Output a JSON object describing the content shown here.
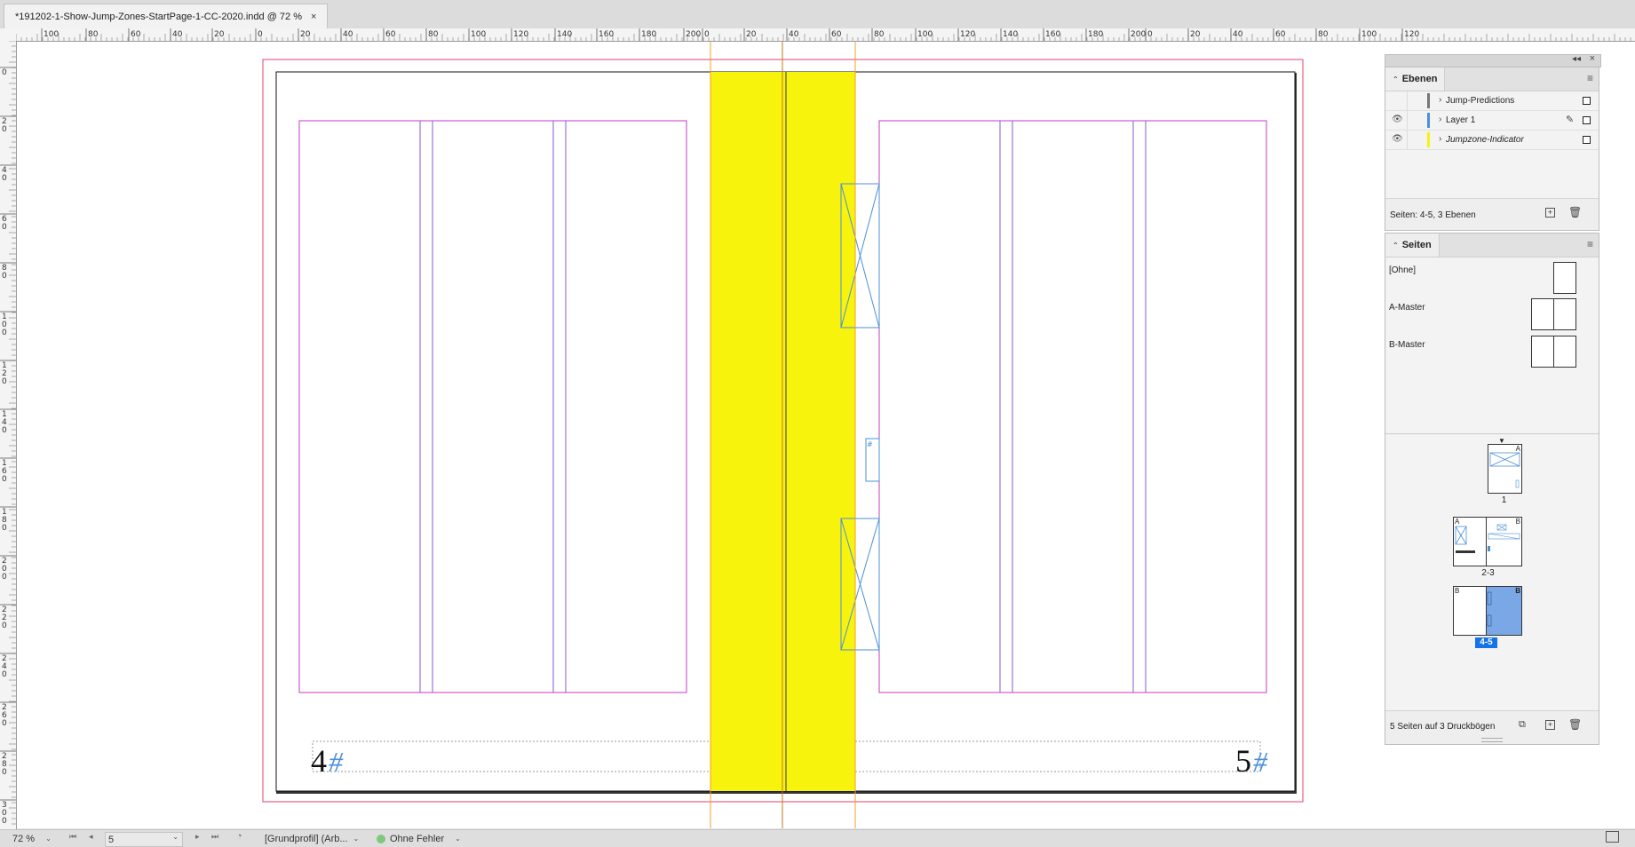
{
  "document_tab": {
    "title": "*191202-1-Show-Jump-Zones-StartPage-1-CC-2020.indd @ 72 %",
    "close_glyph": "×"
  },
  "rulers": {
    "horizontal_labels": [
      "100",
      "80",
      "60",
      "40",
      "20",
      "0",
      "20",
      "40",
      "60",
      "80",
      "100",
      "120",
      "140",
      "160",
      "180",
      "200",
      "0",
      "20",
      "40",
      "60",
      "80",
      "100",
      "120",
      "140",
      "160",
      "180",
      "200",
      "0",
      "20",
      "40",
      "60",
      "80",
      "100",
      "120"
    ],
    "vertical_labels": [
      "0",
      "20",
      "40",
      "60",
      "80",
      "100",
      "120",
      "140",
      "160",
      "180",
      "200",
      "220",
      "240",
      "260",
      "280",
      "300"
    ]
  },
  "spread": {
    "left_page_number": "4",
    "right_page_number": "5",
    "page_marker_glyph": "#",
    "frame_marker_glyph": "#"
  },
  "colors": {
    "jumpzone_yellow": "#f7f30d",
    "guide_orange": "#f0a020",
    "margin_magenta": "#c33bc3",
    "column_violet": "#8a5ad6",
    "bleed_red": "#e0426a",
    "frame_blue": "#4a8fd8",
    "page_selected": "#7aa8e6",
    "label_selected": "#1473e6"
  },
  "layers_panel": {
    "title": "Ebenen",
    "layers": [
      {
        "name": "Jump-Predictions",
        "visible": false,
        "color": "#777777",
        "italic": false,
        "locked_icon": false
      },
      {
        "name": "Layer 1",
        "visible": true,
        "color": "#4a8fd8",
        "italic": false,
        "locked_icon": true
      },
      {
        "name": "Jumpzone-Indicator",
        "visible": true,
        "color": "#f7f30d",
        "italic": true,
        "locked_icon": false
      }
    ],
    "footer": "Seiten: 4-5, 3 Ebenen"
  },
  "pages_panel": {
    "title": "Seiten",
    "masters": [
      "[Ohne]",
      "A-Master",
      "B-Master"
    ],
    "spreads": [
      {
        "label": "1",
        "selected": false,
        "left_master": "",
        "right_master": "A"
      },
      {
        "label": "2-3",
        "selected": false,
        "left_master": "A",
        "right_master": "B"
      },
      {
        "label": "4-5",
        "selected": true,
        "left_master": "B",
        "right_master": "B"
      }
    ],
    "footer": "5 Seiten auf 3 Druckbögen"
  },
  "status_bar": {
    "zoom": "72 %",
    "page": "5",
    "profile": "[Grundprofil] (Arb...",
    "preflight": "Ohne Fehler",
    "preflight_color": "#7fc77f"
  }
}
